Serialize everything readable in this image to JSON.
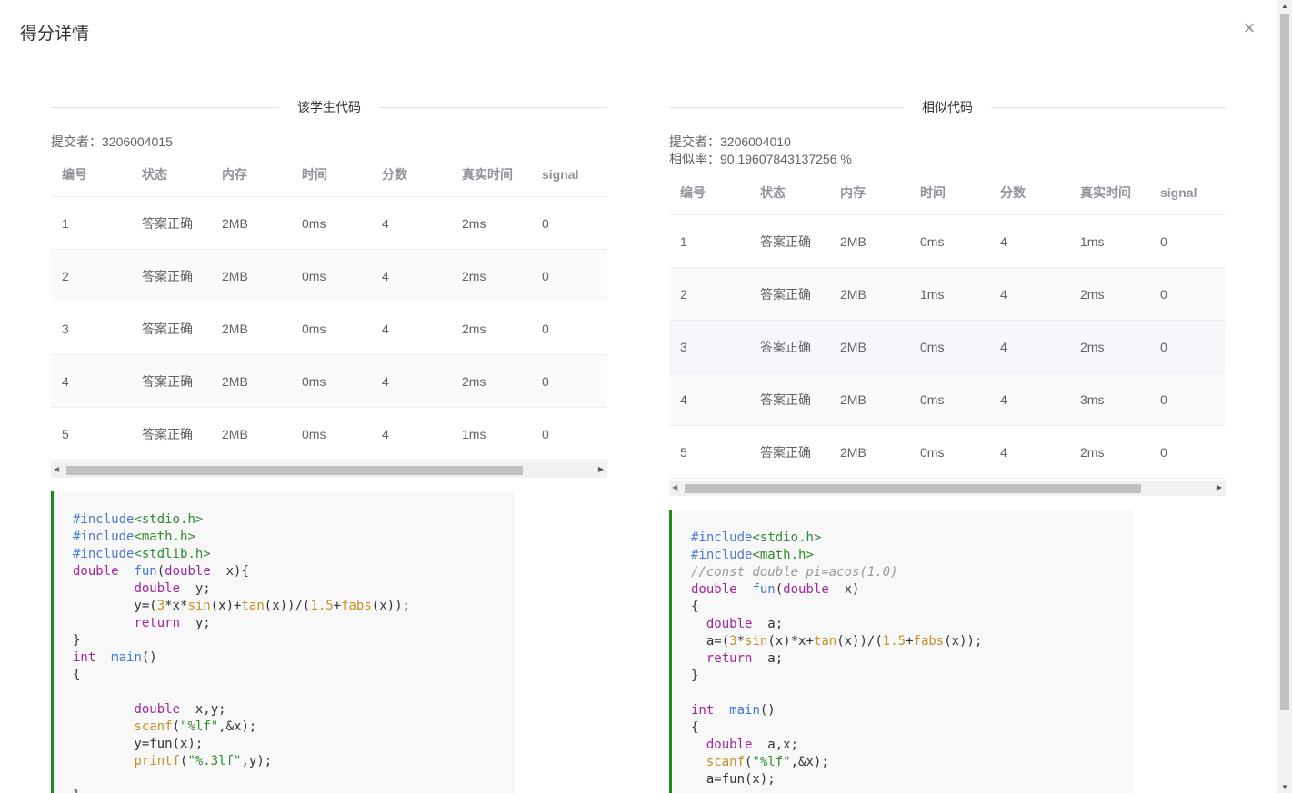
{
  "dialog": {
    "title": "得分详情",
    "close_label": "×"
  },
  "table_headers": [
    "编号",
    "状态",
    "内存",
    "时间",
    "分数",
    "真实时间",
    "signal"
  ],
  "left": {
    "section_title": "该学生代码",
    "submitter_label": "提交者：",
    "submitter": "3206004015",
    "rows": [
      [
        "1",
        "答案正确",
        "2MB",
        "0ms",
        "4",
        "2ms",
        "0"
      ],
      [
        "2",
        "答案正确",
        "2MB",
        "0ms",
        "4",
        "2ms",
        "0"
      ],
      [
        "3",
        "答案正确",
        "2MB",
        "0ms",
        "4",
        "2ms",
        "0"
      ],
      [
        "4",
        "答案正确",
        "2MB",
        "0ms",
        "4",
        "2ms",
        "0"
      ],
      [
        "5",
        "答案正确",
        "2MB",
        "0ms",
        "4",
        "1ms",
        "0"
      ]
    ]
  },
  "right": {
    "section_title": "相似代码",
    "submitter_label": "提交者：",
    "submitter": "3206004010",
    "similarity_label": "相似率：",
    "similarity": "90.19607843137256 %",
    "rows": [
      [
        "1",
        "答案正确",
        "2MB",
        "0ms",
        "4",
        "1ms",
        "0"
      ],
      [
        "2",
        "答案正确",
        "2MB",
        "1ms",
        "4",
        "2ms",
        "0"
      ],
      [
        "3",
        "答案正确",
        "2MB",
        "0ms",
        "4",
        "2ms",
        "0"
      ],
      [
        "4",
        "答案正确",
        "2MB",
        "0ms",
        "4",
        "3ms",
        "0"
      ],
      [
        "5",
        "答案正确",
        "2MB",
        "0ms",
        "4",
        "2ms",
        "0"
      ]
    ]
  },
  "code_left": [
    [
      [
        "k-pre",
        "#include"
      ],
      [
        "k-inc",
        "<stdio.h>"
      ]
    ],
    [
      [
        "k-pre",
        "#include"
      ],
      [
        "k-inc",
        "<math.h>"
      ]
    ],
    [
      [
        "k-pre",
        "#include"
      ],
      [
        "k-inc",
        "<stdlib.h>"
      ]
    ],
    [
      [
        "k-type",
        "double"
      ],
      [
        "",
        "  "
      ],
      [
        "k-fn",
        "fun"
      ],
      [
        "",
        "("
      ],
      [
        "k-type",
        "double"
      ],
      [
        "",
        "  x){"
      ]
    ],
    [
      [
        "",
        "        "
      ],
      [
        "k-type",
        "double"
      ],
      [
        "",
        "  y;"
      ]
    ],
    [
      [
        "",
        "        y=("
      ],
      [
        "k-num",
        "3"
      ],
      [
        "",
        "*x*"
      ],
      [
        "k-call",
        "sin"
      ],
      [
        "",
        "(x)+"
      ],
      [
        "k-call",
        "tan"
      ],
      [
        "",
        "(x))/("
      ],
      [
        "k-num",
        "1.5"
      ],
      [
        "",
        "+"
      ],
      [
        "k-call",
        "fabs"
      ],
      [
        "",
        "(x));"
      ]
    ],
    [
      [
        "",
        "        "
      ],
      [
        "k-type",
        "return"
      ],
      [
        "",
        "  y;"
      ]
    ],
    [
      [
        "",
        "}"
      ]
    ],
    [
      [
        "k-type",
        "int"
      ],
      [
        "",
        "  "
      ],
      [
        "k-fn",
        "main"
      ],
      [
        "",
        "()"
      ]
    ],
    [
      [
        "",
        "{"
      ]
    ],
    [
      [
        "",
        ""
      ]
    ],
    [
      [
        "",
        "        "
      ],
      [
        "k-type",
        "double"
      ],
      [
        "",
        "  x,y;"
      ]
    ],
    [
      [
        "",
        "        "
      ],
      [
        "k-call",
        "scanf"
      ],
      [
        "",
        "("
      ],
      [
        "k-str",
        "\"%lf\""
      ],
      [
        "",
        ",&x);"
      ]
    ],
    [
      [
        "",
        "        y=fun(x);"
      ]
    ],
    [
      [
        "",
        "        "
      ],
      [
        "k-call",
        "printf"
      ],
      [
        "",
        "("
      ],
      [
        "k-str",
        "\"%.3lf\""
      ],
      [
        "",
        ",y);"
      ]
    ],
    [
      [
        "",
        ""
      ]
    ],
    [
      [
        "",
        "}"
      ]
    ]
  ],
  "code_right": [
    [
      [
        "k-pre",
        "#include"
      ],
      [
        "k-inc",
        "<stdio.h>"
      ]
    ],
    [
      [
        "k-pre",
        "#include"
      ],
      [
        "k-inc",
        "<math.h>"
      ]
    ],
    [
      [
        "k-cmt",
        "//const double pi=acos(1.0)"
      ]
    ],
    [
      [
        "k-type",
        "double"
      ],
      [
        "",
        "  "
      ],
      [
        "k-fn",
        "fun"
      ],
      [
        "",
        "("
      ],
      [
        "k-type",
        "double"
      ],
      [
        "",
        "  x)"
      ]
    ],
    [
      [
        "",
        "{"
      ]
    ],
    [
      [
        "",
        "  "
      ],
      [
        "k-type",
        "double"
      ],
      [
        "",
        "  a;"
      ]
    ],
    [
      [
        "",
        "  a=("
      ],
      [
        "k-num",
        "3"
      ],
      [
        "",
        "*"
      ],
      [
        "k-call",
        "sin"
      ],
      [
        "",
        "(x)*x+"
      ],
      [
        "k-call",
        "tan"
      ],
      [
        "",
        "(x))/("
      ],
      [
        "k-num",
        "1.5"
      ],
      [
        "",
        "+"
      ],
      [
        "k-call",
        "fabs"
      ],
      [
        "",
        "(x));"
      ]
    ],
    [
      [
        "",
        "  "
      ],
      [
        "k-type",
        "return"
      ],
      [
        "",
        "  a;"
      ]
    ],
    [
      [
        "",
        "}"
      ]
    ],
    [
      [
        "",
        ""
      ]
    ],
    [
      [
        "k-type",
        "int"
      ],
      [
        "",
        "  "
      ],
      [
        "k-fn",
        "main"
      ],
      [
        "",
        "()"
      ]
    ],
    [
      [
        "",
        "{"
      ]
    ],
    [
      [
        "",
        "  "
      ],
      [
        "k-type",
        "double"
      ],
      [
        "",
        "  a,x;"
      ]
    ],
    [
      [
        "",
        "  "
      ],
      [
        "k-call",
        "scanf"
      ],
      [
        "",
        "("
      ],
      [
        "k-str",
        "\"%lf\""
      ],
      [
        "",
        ",&x);"
      ]
    ],
    [
      [
        "",
        "  a=fun(x);"
      ]
    ]
  ]
}
